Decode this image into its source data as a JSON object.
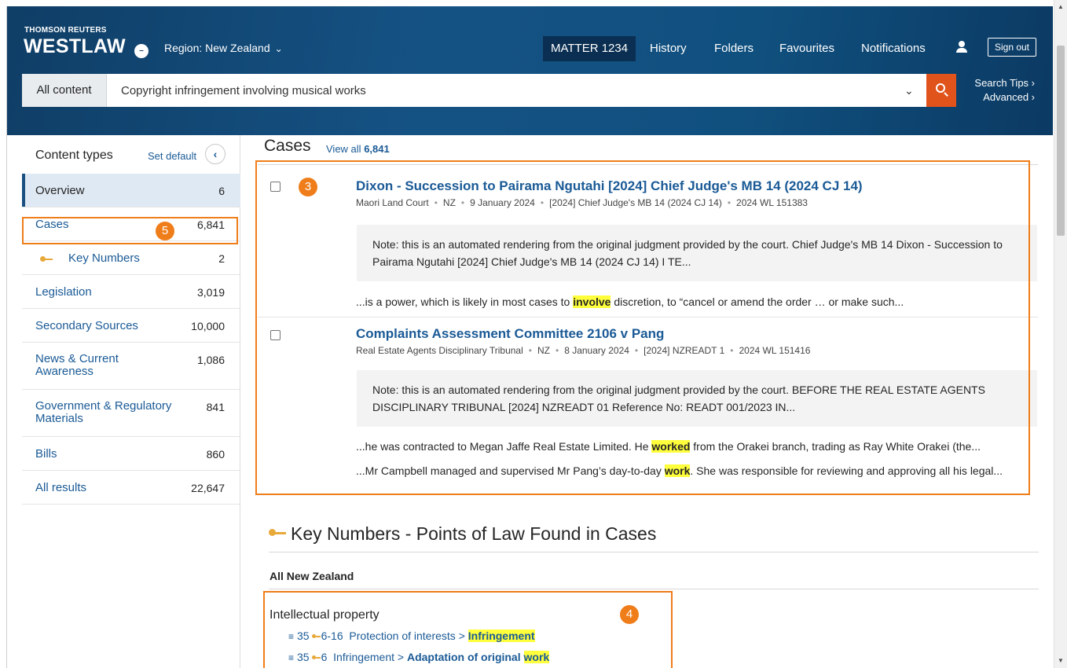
{
  "brand": {
    "small": "THOMSON REUTERS",
    "big": "WESTLAW",
    "toggle_glyph": "–"
  },
  "region": {
    "label": "Region: New Zealand",
    "chevron": "⌵"
  },
  "nav": {
    "matter": "MATTER 1234",
    "history": "History",
    "folders": "Folders",
    "favourites": "Favourites",
    "notifications": "Notifications",
    "sign_out": "Sign out"
  },
  "search": {
    "scope": "All content",
    "query": "Copyright infringement involving musical works",
    "tips": "Search Tips ›",
    "advanced": "Advanced ›"
  },
  "sidebar": {
    "heading": "Content types",
    "set_default": "Set default",
    "items": [
      {
        "label": "Overview",
        "count": "6"
      },
      {
        "label": "Cases",
        "count": "6,841"
      },
      {
        "label": "Key Numbers",
        "count": "2"
      },
      {
        "label": "Legislation",
        "count": "3,019"
      },
      {
        "label": "Secondary Sources",
        "count": "10,000"
      },
      {
        "label": "News & Current Awareness",
        "count": "1,086"
      },
      {
        "label": "Government & Regulatory Materials",
        "count": "841"
      },
      {
        "label": "Bills",
        "count": "860"
      },
      {
        "label": "All results",
        "count": "22,647"
      }
    ]
  },
  "badges": {
    "cases_sidebar": "5",
    "results": "3",
    "key_numbers": "4"
  },
  "cases": {
    "title": "Cases",
    "view_all": "View all",
    "view_all_count": "6,841",
    "results": [
      {
        "title": "Dixon - Succession to Pairama Ngutahi [2024] Chief Judge's MB 14 (2024 CJ 14)",
        "meta": [
          "Maori Land Court",
          "NZ",
          "9 January 2024",
          "[2024] Chief Judge's MB 14 (2024 CJ 14)",
          "2024 WL 151383"
        ],
        "note": "Note: this is an automated rendering from the original judgment provided by the court. Chief Judge's MB 14 Dixon - Succession to Pairama Ngutahi [2024] Chief Judge's MB 14 (2024 CJ 14) I TE...",
        "snippets": [
          {
            "before": "...is a power, which is likely in most cases to ",
            "hit": "involve",
            "after": " discretion, to “cancel or amend the order … or make such..."
          }
        ]
      },
      {
        "title": "Complaints Assessment Committee 2106 v Pang",
        "meta": [
          "Real Estate Agents Disciplinary Tribunal",
          "NZ",
          "8 January 2024",
          "[2024] NZREADT 1",
          "2024 WL 151416"
        ],
        "note": "Note: this is an automated rendering from the original judgment provided by the court. BEFORE THE REAL ESTATE AGENTS DISCIPLINARY TRIBUNAL [2024] NZREADT 01 Reference No: READT 001/2023 IN...",
        "snippets": [
          {
            "before": "...he was contracted to Megan Jaffe Real Estate Limited. He ",
            "hit": "worked",
            "after": " from the Orakei branch, trading as Ray White Orakei (the..."
          },
          {
            "before": "...Mr Campbell managed and supervised Mr Pang’s day-to-day ",
            "hit": "work",
            "after": ". She was responsible for reviewing and approving all his legal..."
          }
        ]
      }
    ]
  },
  "key_numbers": {
    "title": "Key Numbers - Points of Law Found in Cases",
    "jurisdiction": "All New Zealand",
    "topic": "Intellectual property",
    "rows": [
      {
        "num": "35",
        "key": "6-16",
        "path": "Protection of interests > ",
        "hit": "Infringement",
        "bold_path": ""
      },
      {
        "num": "35",
        "key": "6",
        "path": "Infringement > ",
        "bold_path": "Adaptation of original ",
        "hit": "work"
      }
    ]
  },
  "icons": {
    "collapse": "‹",
    "search_chevron": "⌵",
    "tree": "⭾",
    "scroll_up": "▲",
    "scroll_down": "▼"
  },
  "colors": {
    "brand_blue": "#155284",
    "accent_orange": "#e0541c",
    "link_blue": "#1a5a96",
    "annotation_orange": "#ef7d1a",
    "highlight": "#ffff3c"
  }
}
